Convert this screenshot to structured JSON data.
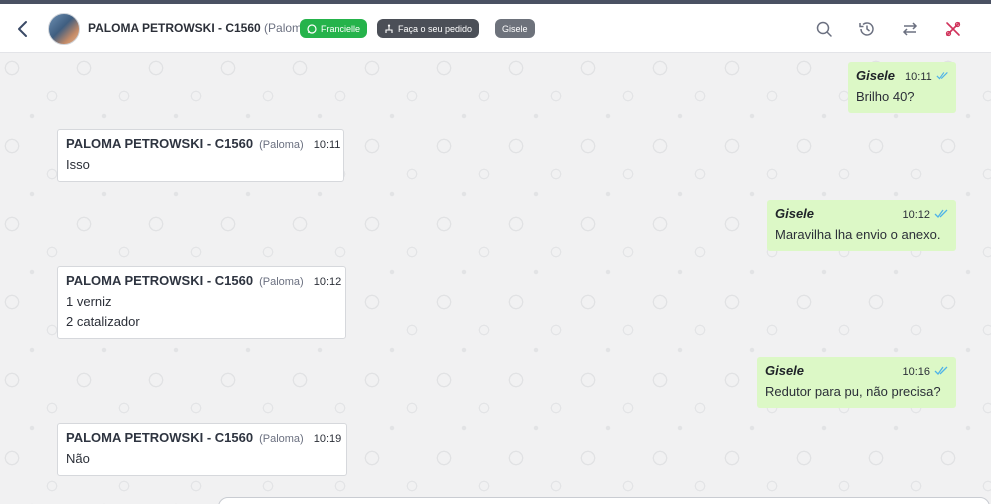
{
  "header": {
    "contact_name": "PALOMA PETROWSKI - C1560",
    "contact_nick": "(Paloma)",
    "tags": [
      "Francielle",
      "Faça o seu pedido",
      "Gisele"
    ],
    "icons": [
      "back-chevron-icon",
      "search-icon",
      "history-icon",
      "transfer-icon",
      "close-ticket-icon"
    ],
    "colors": {
      "tag_green": "#25b34b",
      "tag_dark": "#4b4f57",
      "tag_grey": "#6d727b",
      "close_icon": "#d0335b"
    }
  },
  "messages": [
    {
      "direction": "out",
      "sender": "Gisele",
      "time": "10:11",
      "lines": [
        "Brilho 40?"
      ]
    },
    {
      "direction": "in",
      "sender": "PALOMA PETROWSKI - C1560",
      "nick": "(Paloma)",
      "time": "10:11",
      "lines": [
        "Isso"
      ]
    },
    {
      "direction": "out",
      "sender": "Gisele",
      "time": "10:12",
      "lines": [
        "Maravilha lha envio o anexo."
      ]
    },
    {
      "direction": "in",
      "sender": "PALOMA PETROWSKI - C1560",
      "nick": "(Paloma)",
      "time": "10:12",
      "lines": [
        "1 verniz",
        "2 catalizador"
      ]
    },
    {
      "direction": "out",
      "sender": "Gisele",
      "time": "10:16",
      "lines": [
        "Redutor para pu, não precisa?"
      ]
    },
    {
      "direction": "in",
      "sender": "PALOMA PETROWSKI - C1560",
      "nick": "(Paloma)",
      "time": "10:19",
      "lines": [
        "Não"
      ]
    }
  ],
  "colors": {
    "outgoing_bubble": "#dcf8c6",
    "incoming_bubble": "#ffffff",
    "read_ticks": "#4fb3e8"
  }
}
